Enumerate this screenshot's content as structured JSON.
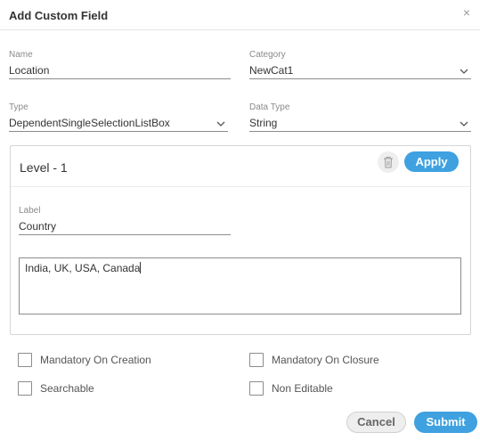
{
  "dialog": {
    "title": "Add Custom Field",
    "close_icon": "close-icon",
    "close_glyph": "×"
  },
  "form": {
    "name": {
      "label": "Name",
      "value": "Location"
    },
    "category": {
      "label": "Category",
      "value": "NewCat1"
    },
    "type": {
      "label": "Type",
      "value": "DependentSingleSelectionListBox"
    },
    "data_type": {
      "label": "Data Type",
      "value": "String"
    }
  },
  "level": {
    "title": "Level - 1",
    "delete_icon": "trash-icon",
    "apply_label": "Apply",
    "label_field": {
      "label": "Label",
      "value": "Country"
    },
    "values_text": "India, UK, USA, Canada"
  },
  "options": {
    "mandatory_on_creation": {
      "label": "Mandatory On Creation",
      "checked": false
    },
    "mandatory_on_closure": {
      "label": "Mandatory On Closure",
      "checked": false
    },
    "searchable": {
      "label": "Searchable",
      "checked": false
    },
    "non_editable": {
      "label": "Non Editable",
      "checked": false
    }
  },
  "footer": {
    "cancel_label": "Cancel",
    "submit_label": "Submit"
  },
  "colors": {
    "accent": "#3fa1e0",
    "border": "#8c8c8c",
    "muted_label": "#8a8a8a"
  }
}
